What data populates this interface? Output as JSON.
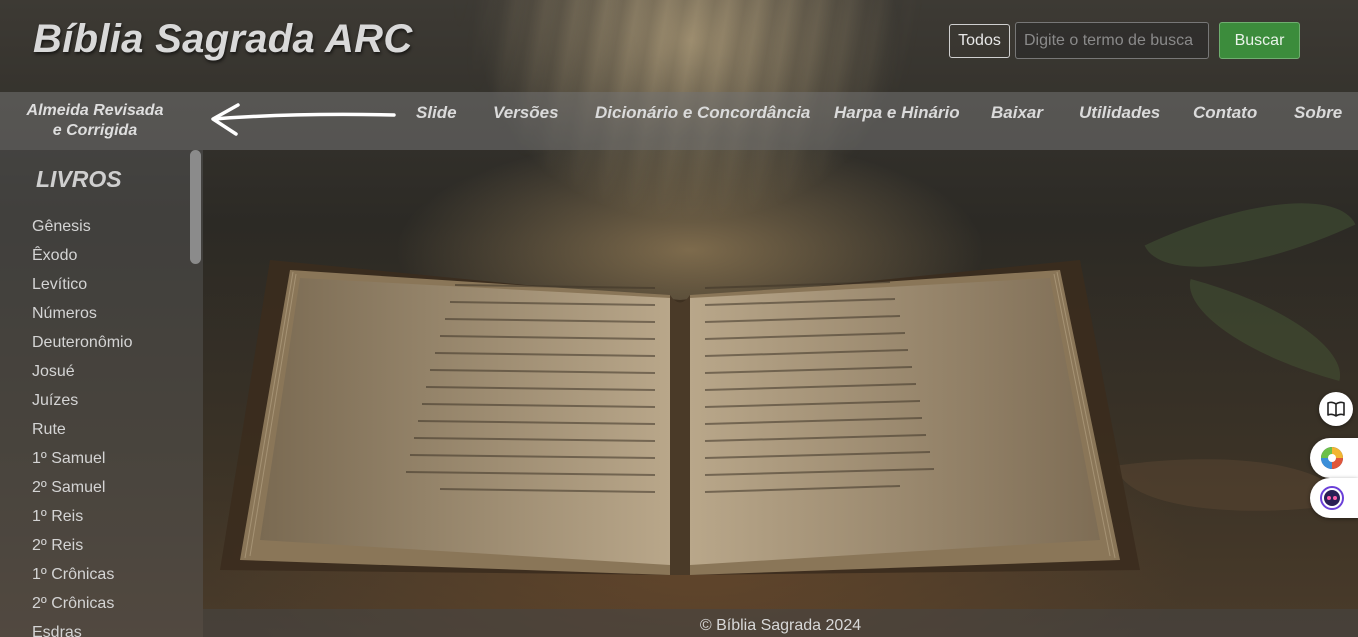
{
  "header": {
    "title": "Bíblia Sagrada ARC"
  },
  "search": {
    "filter_value": "Todos",
    "placeholder": "Digite o termo de busca",
    "button_label": "Buscar"
  },
  "nav": {
    "version_label": "Almeida Revisada e Corrigida",
    "items": [
      {
        "label": "Slide"
      },
      {
        "label": "Versões"
      },
      {
        "label": "Dicionário e Concordância"
      },
      {
        "label": "Harpa e Hinário"
      },
      {
        "label": "Baixar"
      },
      {
        "label": "Utilidades"
      },
      {
        "label": "Contato"
      },
      {
        "label": "Sobre"
      }
    ]
  },
  "sidebar": {
    "heading": "LIVROS",
    "books": [
      {
        "name": "Gênesis"
      },
      {
        "name": "Êxodo"
      },
      {
        "name": "Levítico"
      },
      {
        "name": "Números"
      },
      {
        "name": "Deuteronômio"
      },
      {
        "name": "Josué"
      },
      {
        "name": "Juízes"
      },
      {
        "name": "Rute"
      },
      {
        "name": "1º Samuel"
      },
      {
        "name": "2º Samuel"
      },
      {
        "name": "1º Reis"
      },
      {
        "name": "2º Reis"
      },
      {
        "name": "1º Crônicas"
      },
      {
        "name": "2º Crônicas"
      },
      {
        "name": "Esdras"
      }
    ]
  },
  "footer": {
    "text": "© Bíblia Sagrada 2024"
  },
  "floating": {
    "icons": [
      "book-open-icon",
      "color-palette-icon",
      "assistant-face-icon"
    ]
  },
  "colors": {
    "buscar_button": "#3c8c3c",
    "navbar": "#737373",
    "text_light": "#d9d9d9"
  }
}
